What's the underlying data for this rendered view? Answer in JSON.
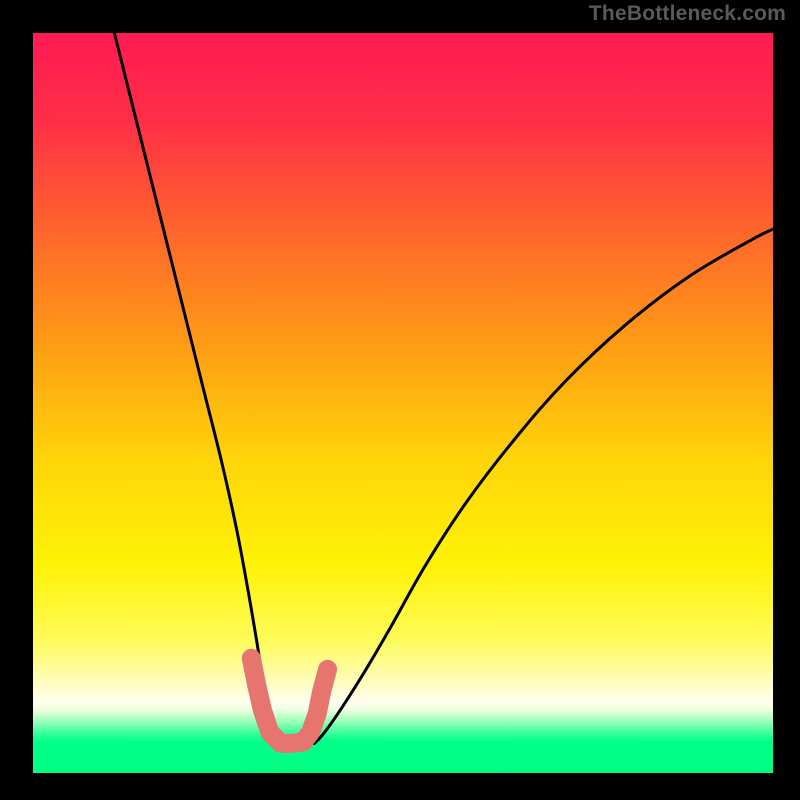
{
  "attribution": "TheBottleneck.com",
  "chart_data": {
    "type": "line",
    "title": "",
    "xlabel": "",
    "ylabel": "",
    "xlim": [
      0,
      100
    ],
    "ylim": [
      0,
      100
    ],
    "gradient_stops": [
      {
        "offset": 0.0,
        "color": "#ff1a54"
      },
      {
        "offset": 0.12,
        "color": "#ff2f47"
      },
      {
        "offset": 0.28,
        "color": "#ff6a2a"
      },
      {
        "offset": 0.44,
        "color": "#ffa313"
      },
      {
        "offset": 0.58,
        "color": "#ffd60a"
      },
      {
        "offset": 0.72,
        "color": "#fff207"
      },
      {
        "offset": 0.82,
        "color": "#fffb5a"
      },
      {
        "offset": 0.88,
        "color": "#fffdc2"
      },
      {
        "offset": 0.905,
        "color": "#fffef0"
      },
      {
        "offset": 0.916,
        "color": "#e9ffda"
      },
      {
        "offset": 0.931,
        "color": "#97ffb7"
      },
      {
        "offset": 0.945,
        "color": "#3dff9d"
      },
      {
        "offset": 0.958,
        "color": "#00ff8a"
      },
      {
        "offset": 1.0,
        "color": "#00ff80"
      }
    ],
    "series": [
      {
        "name": "left-curve",
        "style": "line",
        "color": "#000000",
        "x": [
          11.0,
          14.0,
          17.0,
          20.0,
          23.0,
          25.5,
          27.5,
          29.0,
          30.2,
          31.0,
          31.8,
          32.4,
          32.9,
          33.3
        ],
        "y": [
          100.0,
          88.0,
          76.0,
          64.0,
          52.0,
          42.0,
          33.0,
          25.0,
          18.0,
          13.0,
          9.0,
          6.0,
          4.5,
          4.0
        ]
      },
      {
        "name": "right-curve",
        "style": "line",
        "color": "#000000",
        "x": [
          38.0,
          39.0,
          40.5,
          42.5,
          45.0,
          48.5,
          53.0,
          58.5,
          65.0,
          72.0,
          80.0,
          88.5,
          97.0,
          100.0
        ],
        "y": [
          4.0,
          5.0,
          7.0,
          10.0,
          14.0,
          20.0,
          28.0,
          36.5,
          45.0,
          53.0,
          60.5,
          67.0,
          72.0,
          73.5
        ]
      },
      {
        "name": "bottom-overlay",
        "style": "marker-blob",
        "color": "#e6746f",
        "x": [
          29.5,
          30.2,
          31.0,
          32.0,
          33.5,
          35.0,
          36.5,
          37.5,
          38.4,
          39.0,
          39.8
        ],
        "y": [
          15.5,
          12.0,
          8.5,
          5.5,
          4.0,
          4.0,
          4.2,
          5.5,
          8.0,
          11.0,
          14.0
        ]
      }
    ],
    "annotations": []
  }
}
